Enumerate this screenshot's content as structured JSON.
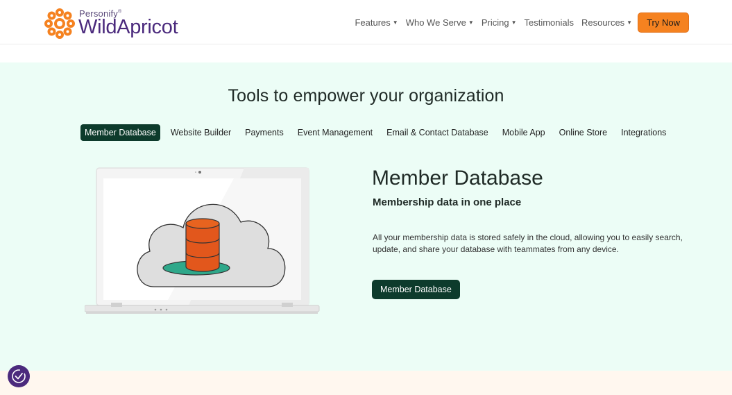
{
  "header": {
    "logo_small": "Personify",
    "logo_mark": "®",
    "logo_big": "WildApricot",
    "nav": [
      {
        "label": "Features",
        "dropdown": true
      },
      {
        "label": "Who We Serve",
        "dropdown": true
      },
      {
        "label": "Pricing",
        "dropdown": true
      },
      {
        "label": "Testimonials",
        "dropdown": false
      },
      {
        "label": "Resources",
        "dropdown": true
      }
    ],
    "cta_label": "Try Now"
  },
  "tools": {
    "title": "Tools to empower your organization",
    "tabs": [
      {
        "label": "Member Database",
        "active": true
      },
      {
        "label": "Website Builder",
        "active": false
      },
      {
        "label": "Payments",
        "active": false
      },
      {
        "label": "Event Management",
        "active": false
      },
      {
        "label": "Email & Contact Database",
        "active": false
      },
      {
        "label": "Mobile App",
        "active": false
      },
      {
        "label": "Online Store",
        "active": false
      },
      {
        "label": "Integrations",
        "active": false
      }
    ],
    "feature": {
      "title": "Member Database",
      "subtitle": "Membership data in one place",
      "description": "All your membership data is stored safely in the cloud, allowing you to easily search, update, and share your database with teammates from any device.",
      "button_label": "Member Database"
    }
  },
  "icons": {
    "caret": "caret-down-icon",
    "consent": "privacy-consent-icon",
    "illustration": "laptop-cloud-database-illustration"
  },
  "colors": {
    "brand_purple": "#4b2a7d",
    "brand_orange": "#f58220",
    "dark_green": "#0d3b2c",
    "section_bg": "#ecfdf6",
    "database_orange": "#e2571c",
    "platform_teal": "#2fa88a"
  }
}
